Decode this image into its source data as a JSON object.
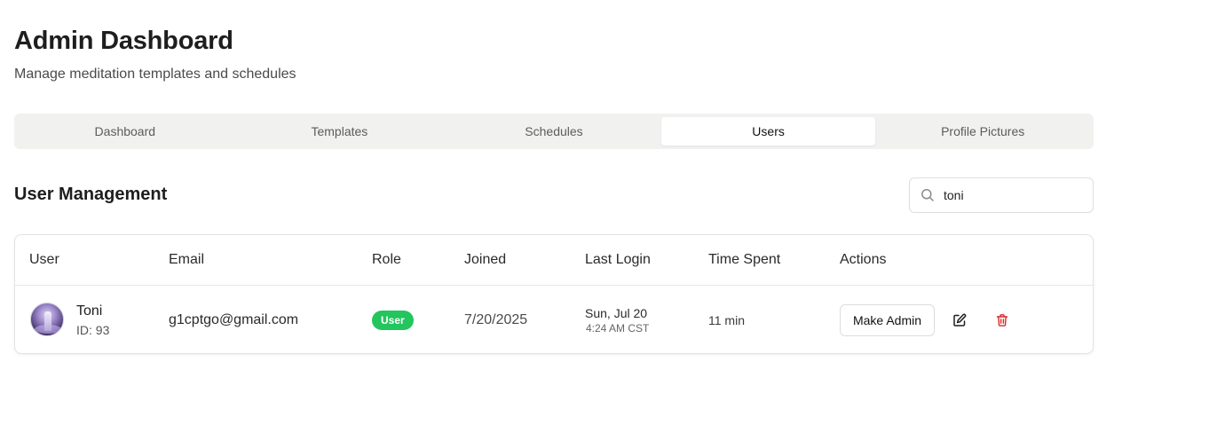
{
  "header": {
    "title": "Admin Dashboard",
    "subtitle": "Manage meditation templates and schedules"
  },
  "tabs": [
    {
      "label": "Dashboard",
      "active": false
    },
    {
      "label": "Templates",
      "active": false
    },
    {
      "label": "Schedules",
      "active": false
    },
    {
      "label": "Users",
      "active": true
    },
    {
      "label": "Profile Pictures",
      "active": false
    }
  ],
  "section": {
    "title": "User Management"
  },
  "search": {
    "value": "toni",
    "icon": "search-icon"
  },
  "table": {
    "columns": [
      "User",
      "Email",
      "Role",
      "Joined",
      "Last Login",
      "Time Spent",
      "Actions"
    ],
    "rows": [
      {
        "name": "Toni",
        "id": "ID: 93",
        "email": "g1cptgo@gmail.com",
        "role": "User",
        "joined": "7/20/2025",
        "last_login_date": "Sun, Jul 20",
        "last_login_time": "4:24 AM CST",
        "time_spent": "11 min",
        "make_admin_label": "Make Admin"
      }
    ]
  },
  "colors": {
    "role_badge": "#22c55e",
    "delete_icon": "#dc2626",
    "tabs_background": "#f1f1f0"
  }
}
